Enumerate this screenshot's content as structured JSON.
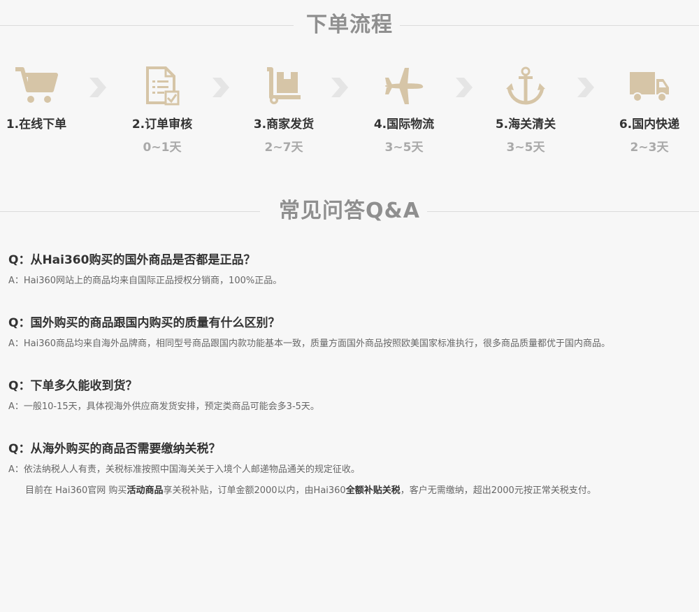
{
  "process": {
    "title": "下单流程",
    "steps": [
      {
        "name": "1.在线下单",
        "days": "",
        "icon": "cart-icon"
      },
      {
        "name": "2.订单审核",
        "days": "0~1天",
        "icon": "document-check-icon"
      },
      {
        "name": "3.商家发货",
        "days": "2~7天",
        "icon": "hand-truck-icon"
      },
      {
        "name": "4.国际物流",
        "days": "3~5天",
        "icon": "airplane-icon"
      },
      {
        "name": "5.海关清关",
        "days": "3~5天",
        "icon": "anchor-icon"
      },
      {
        "name": "6.国内快递",
        "days": "2~3天",
        "icon": "delivery-truck-icon"
      }
    ]
  },
  "faq": {
    "title": "常见问答Q&A",
    "items": [
      {
        "q": "Q：从Hai360购买的国外商品是否都是正品？",
        "a": "A：Hai360网站上的商品均来自国际正品授权分销商，100%正品。"
      },
      {
        "q": "Q：国外购买的商品跟国内购买的质量有什么区别？",
        "a": "A：Hai360商品均来自海外品牌商，相同型号商品跟国内款功能基本一致，质量方面国外商品按照欧美国家标准执行，很多商品质量都优于国内商品。"
      },
      {
        "q": "Q：下单多久能收到货？",
        "a": "A：一般10-15天，具体视海外供应商发货安排，预定类商品可能会多3-5天。"
      },
      {
        "q": "Q：从海外购买的商品否需要缴纳关税？",
        "a": "A：依法纳税人人有责，关税标准按照中国海关关于入境个人邮递物品通关的规定征收。",
        "a2_p1": "目前在 Hai360官网 购买",
        "a2_b1": "活动商品",
        "a2_p2": "享关税补贴，订单金额2000以内，由Hai360",
        "a2_b2": "全额补贴关税",
        "a2_p3": "，客户无需缴纳，超出2000元按正常关税支付。"
      }
    ]
  },
  "colors": {
    "icon": "#d6c5a7",
    "arrow": "#e5e5e5",
    "line": "#dcdcdc"
  }
}
